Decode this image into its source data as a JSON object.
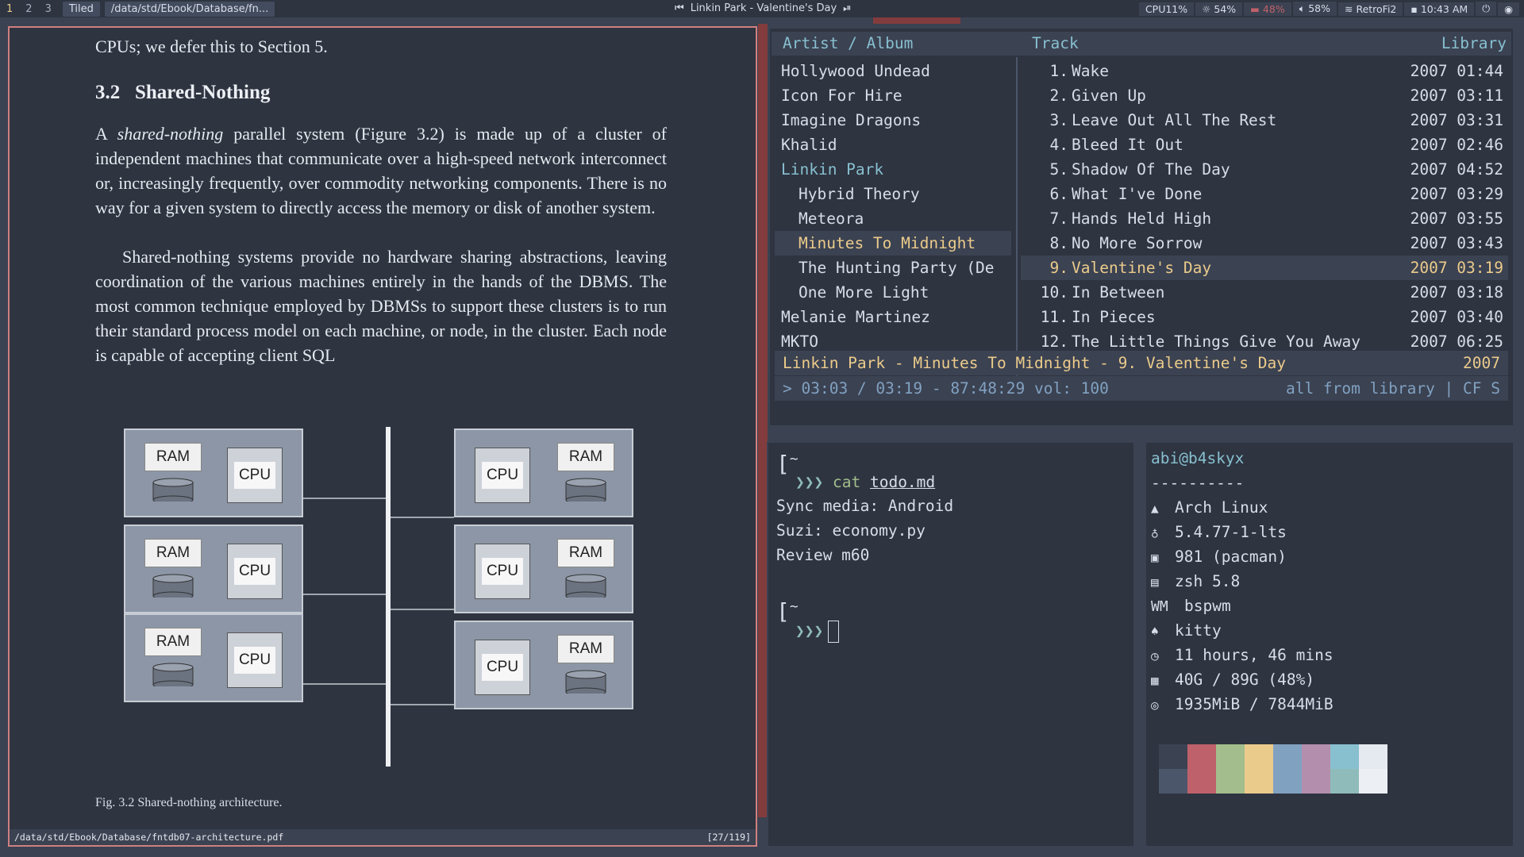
{
  "topbar": {
    "workspaces": [
      "1",
      "2",
      "3"
    ],
    "layout": "Tiled",
    "window_title": "/data/std/Ebook/Database/fn...",
    "now_playing": "Linkin Park - Valentine's Day",
    "cpu": "CPU11%",
    "brightness": "54%",
    "battery": "48%",
    "volume": "58%",
    "wifi": "RetroFi2",
    "clock": "10:43 AM"
  },
  "pdf": {
    "top_fragment": "CPUs; we defer this to Section 5.",
    "section_number": "3.2",
    "section_title": "Shared-Nothing",
    "para1_pre": "A ",
    "para1_em": "shared-nothing",
    "para1_post": " parallel system (Figure 3.2) is made up of a cluster of independent machines that communicate over a high-speed network interconnect or, increasingly frequently, over commodity networking components. There is no way for a given system to directly access the memory or disk of another system.",
    "para2": "Shared-nothing systems provide no hardware sharing abstractions, leaving coordination of the various machines entirely in the hands of the DBMS. The most common technique employed by DBMSs to support these clusters is to run their standard process model on each machine, or node, in the cluster. Each node is capable of accepting client SQL",
    "ram_label": "RAM",
    "cpu_label": "CPU",
    "caption": "Fig. 3.2  Shared-nothing architecture.",
    "status_path": "/data/std/Ebook/Database/fntdb07-architecture.pdf",
    "status_page": "[27/119]"
  },
  "cmus": {
    "col_artist": "Artist / Album",
    "col_track": "Track",
    "col_library": "Library",
    "artists": [
      {
        "name": "Hollywood Undead",
        "indent": false
      },
      {
        "name": "Icon For Hire",
        "indent": false
      },
      {
        "name": "Imagine Dragons",
        "indent": false
      },
      {
        "name": "Khalid",
        "indent": false
      },
      {
        "name": "Linkin Park",
        "indent": false,
        "accent": true
      },
      {
        "name": "Hybrid Theory",
        "indent": true
      },
      {
        "name": "Meteora",
        "indent": true
      },
      {
        "name": "Minutes To Midnight",
        "indent": true,
        "selected": true
      },
      {
        "name": "The Hunting Party (De",
        "indent": true
      },
      {
        "name": "One More Light",
        "indent": true
      },
      {
        "name": "Melanie Martinez",
        "indent": false
      },
      {
        "name": "MKTO",
        "indent": false
      }
    ],
    "tracks": [
      {
        "n": "1.",
        "title": "Wake",
        "year": "2007",
        "dur": "01:44"
      },
      {
        "n": "2.",
        "title": "Given Up",
        "year": "2007",
        "dur": "03:11"
      },
      {
        "n": "3.",
        "title": "Leave Out All The Rest",
        "year": "2007",
        "dur": "03:31"
      },
      {
        "n": "4.",
        "title": "Bleed It Out",
        "year": "2007",
        "dur": "02:46"
      },
      {
        "n": "5.",
        "title": "Shadow Of The Day",
        "year": "2007",
        "dur": "04:52"
      },
      {
        "n": "6.",
        "title": "What I've Done",
        "year": "2007",
        "dur": "03:29"
      },
      {
        "n": "7.",
        "title": "Hands Held High",
        "year": "2007",
        "dur": "03:55"
      },
      {
        "n": "8.",
        "title": "No More Sorrow",
        "year": "2007",
        "dur": "03:43"
      },
      {
        "n": "9.",
        "title": "Valentine's Day",
        "year": "2007",
        "dur": "03:19",
        "playing": true
      },
      {
        "n": "10.",
        "title": "In Between",
        "year": "2007",
        "dur": "03:18"
      },
      {
        "n": "11.",
        "title": "In Pieces",
        "year": "2007",
        "dur": "03:40"
      },
      {
        "n": "12.",
        "title": "The Little Things Give You Away",
        "year": "2007",
        "dur": "06:25"
      }
    ],
    "status_left": "Linkin Park - Minutes To Midnight -  9. Valentine's Day",
    "status_right": "2007",
    "cmd_left": "> 03:03 / 03:19 - 87:48:29 vol: 100",
    "cmd_right": "all from library | CF S"
  },
  "terminal": {
    "prompt_dir": "~",
    "command": "cat",
    "file": "todo.md",
    "lines": [
      "Sync media: Android",
      "Suzi: economy.py",
      "Review m60"
    ],
    "prompt_dir2": "~"
  },
  "neofetch": {
    "userhost": "abi@b4skyx",
    "separator": "----------",
    "rows": [
      {
        "icon": "arch-icon",
        "glyph": "▲",
        "value": "Arch Linux"
      },
      {
        "icon": "tux-icon",
        "glyph": "♁",
        "value": "5.4.77-1-lts"
      },
      {
        "icon": "package-icon",
        "glyph": "▣",
        "value": "981 (pacman)"
      },
      {
        "icon": "shell-icon",
        "glyph": "▤",
        "value": "zsh 5.8"
      },
      {
        "icon": "wm-icon",
        "glyph": "WM",
        "value": "bspwm"
      },
      {
        "icon": "cat-icon",
        "glyph": "♠",
        "value": "kitty"
      },
      {
        "icon": "clock-icon",
        "glyph": "◷",
        "value": "11 hours, 46 mins"
      },
      {
        "icon": "disk-icon",
        "glyph": "▦",
        "value": "40G / 89G (48%)"
      },
      {
        "icon": "memory-icon",
        "glyph": "◎",
        "value": "1935MiB / 7844MiB"
      }
    ],
    "palette_top": [
      "#3b4252",
      "#bf616a",
      "#a3be8c",
      "#ebcb8b",
      "#81a1c1",
      "#b48ead",
      "#88c0d0",
      "#e5e9f0"
    ],
    "palette_bottom": [
      "#4c566a",
      "#bf616a",
      "#a3be8c",
      "#ebcb8b",
      "#81a1c1",
      "#b48ead",
      "#8fbcbb",
      "#eceff4"
    ]
  }
}
